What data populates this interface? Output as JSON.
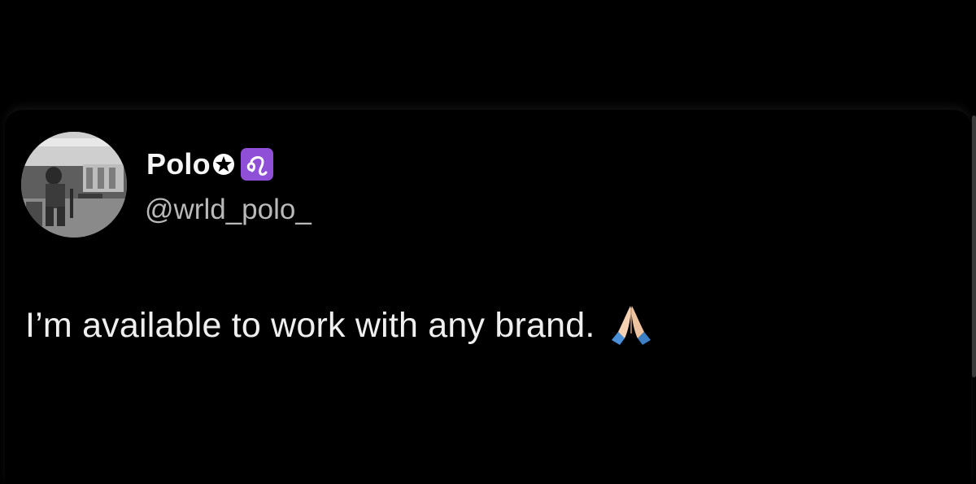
{
  "theme": {
    "background": "#000000",
    "text_primary": "#efefef",
    "text_secondary": "#b9b9b9",
    "badge_purple": "#8f4fd6"
  },
  "post": {
    "author": {
      "display_name": "Polo",
      "handle": "@wrld_polo_",
      "name_icons": [
        "star-icon",
        "leo-zodiac-icon"
      ]
    },
    "text": "I’m available to work with any brand.",
    "trailing_emoji": "folded-hands-icon"
  }
}
